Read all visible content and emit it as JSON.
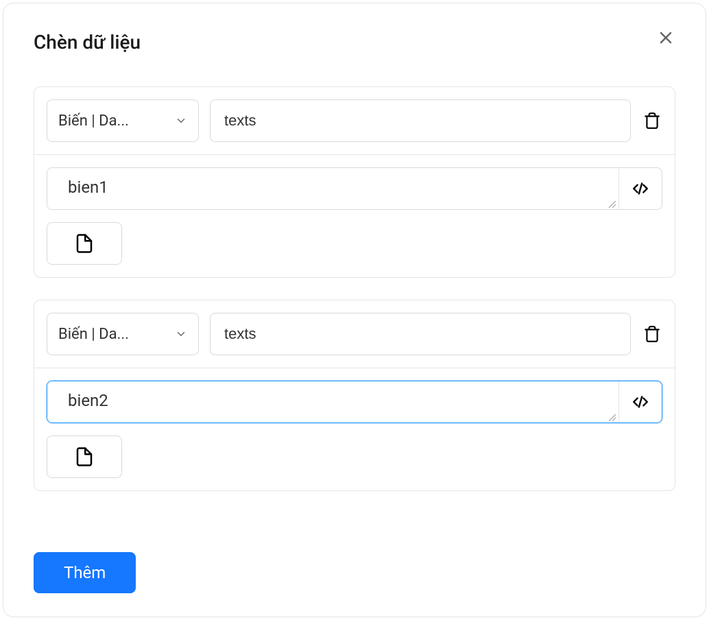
{
  "dialog": {
    "title": "Chèn dữ liệu"
  },
  "groups": [
    {
      "type_label": "Biến | Da...",
      "name_value": "texts",
      "value": "bien1"
    },
    {
      "type_label": "Biến | Da...",
      "name_value": "texts",
      "value": "bien2"
    }
  ],
  "buttons": {
    "add": "Thêm"
  }
}
